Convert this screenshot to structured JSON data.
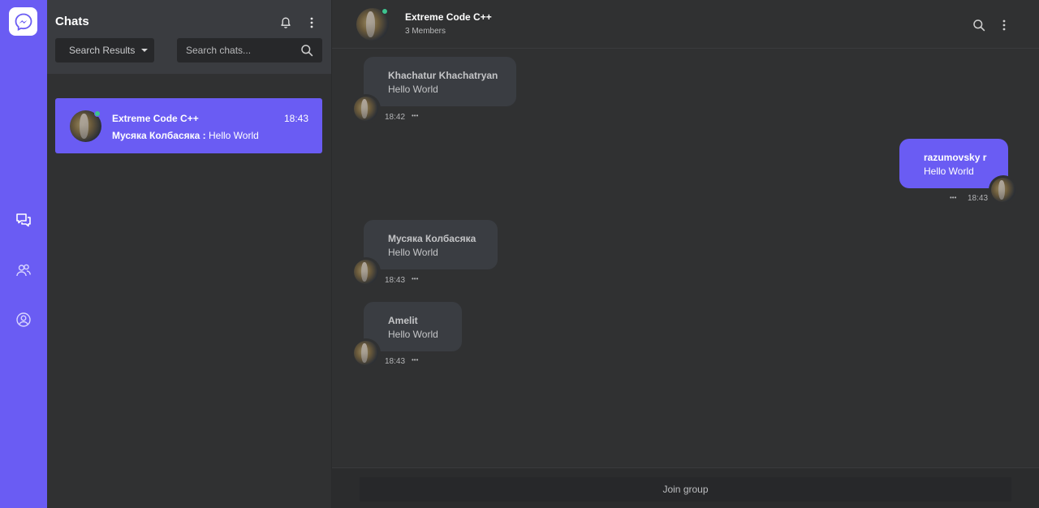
{
  "rail": {
    "logo_icon": "messenger-icon",
    "items": [
      {
        "icon": "chats-icon"
      },
      {
        "icon": "contacts-icon"
      },
      {
        "icon": "profile-icon"
      }
    ],
    "accent": "#6a5cf3"
  },
  "chatlist": {
    "title": "Chats",
    "filter_label": "Search Results",
    "search_placeholder": "Search chats...",
    "items": [
      {
        "name": "Extreme Code C++",
        "time": "18:43",
        "preview_sender": "Мусяка Колбасяка :",
        "preview_text": " Hello World",
        "online": true
      }
    ]
  },
  "conversation": {
    "title": "Extreme Code C++",
    "subtitle": "3 Members",
    "messages": [
      {
        "sender": "Khachatur Khachatryan",
        "text": "Hello World",
        "time": "18:42",
        "outgoing": false
      },
      {
        "sender": "razumovsky r",
        "text": "Hello World",
        "time": "18:43",
        "outgoing": true
      },
      {
        "sender": "Мусяка Колбасяка",
        "text": "Hello World",
        "time": "18:43",
        "outgoing": false
      },
      {
        "sender": "Amelit",
        "text": "Hello World",
        "time": "18:43",
        "outgoing": false
      }
    ],
    "join_label": "Join group",
    "more_dots": "•••"
  }
}
